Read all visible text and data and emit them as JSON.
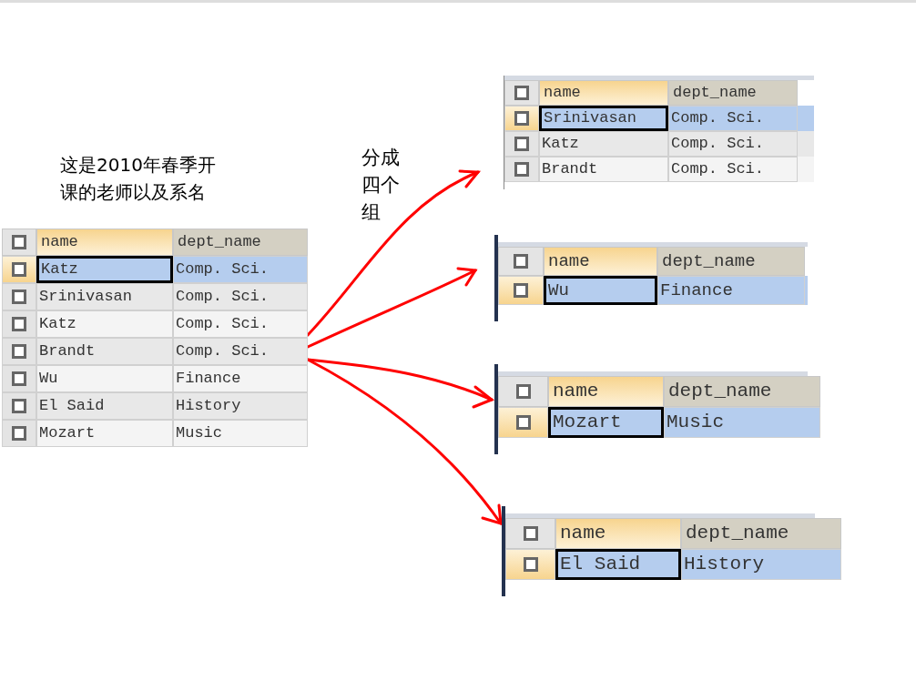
{
  "caption": "这是2010年春季开课的老师以及系名",
  "note": "分成四个组",
  "source_table": {
    "columns": [
      "name",
      "dept_name"
    ],
    "all_checked": false,
    "rows": [
      {
        "cells": [
          "Katz",
          "Comp. Sci."
        ],
        "selected": true,
        "checked": false
      },
      {
        "cells": [
          "Srinivasan",
          "Comp. Sci."
        ],
        "selected": false,
        "checked": false
      },
      {
        "cells": [
          "Katz",
          "Comp. Sci."
        ],
        "selected": false,
        "checked": false
      },
      {
        "cells": [
          "Brandt",
          "Comp. Sci."
        ],
        "selected": false,
        "checked": false
      },
      {
        "cells": [
          "Wu",
          "Finance"
        ],
        "selected": false,
        "checked": false
      },
      {
        "cells": [
          "El Said",
          "History"
        ],
        "selected": false,
        "checked": false
      },
      {
        "cells": [
          "Mozart",
          "Music"
        ],
        "selected": false,
        "checked": false
      }
    ]
  },
  "groups": [
    {
      "columns": [
        "name",
        "dept_name"
      ],
      "all_checked": false,
      "rows": [
        {
          "cells": [
            "Srinivasan",
            "Comp. Sci."
          ],
          "selected": true,
          "checked": false
        },
        {
          "cells": [
            "Katz",
            "Comp. Sci."
          ],
          "selected": false,
          "checked": false
        },
        {
          "cells": [
            "Brandt",
            "Comp. Sci."
          ],
          "selected": false,
          "checked": false
        }
      ]
    },
    {
      "columns": [
        "name",
        "dept_name"
      ],
      "all_checked": false,
      "rows": [
        {
          "cells": [
            "Wu",
            "Finance"
          ],
          "selected": true,
          "checked": false
        }
      ]
    },
    {
      "columns": [
        "name",
        "dept_name"
      ],
      "all_checked": false,
      "rows": [
        {
          "cells": [
            "Mozart",
            "Music"
          ],
          "selected": true,
          "checked": false
        }
      ]
    },
    {
      "columns": [
        "name",
        "dept_name"
      ],
      "all_checked": false,
      "rows": [
        {
          "cells": [
            "El Said",
            "History"
          ],
          "selected": true,
          "checked": false
        }
      ]
    }
  ]
}
